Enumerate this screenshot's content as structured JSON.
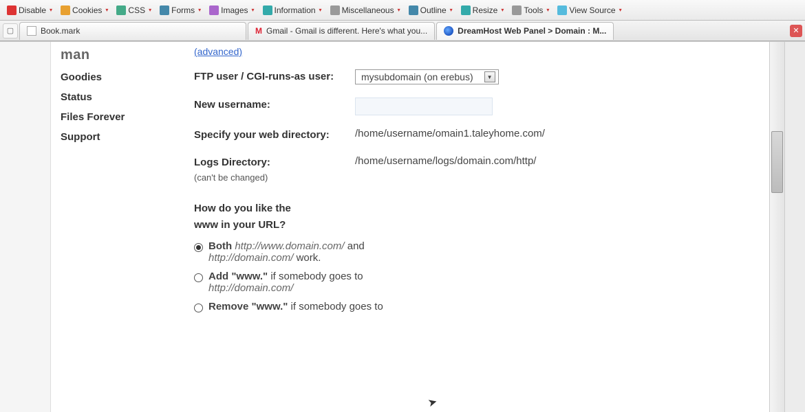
{
  "devtoolbar": {
    "items": [
      {
        "icon": "ico-red",
        "label": "Disable"
      },
      {
        "icon": "ico-orange",
        "label": "Cookies"
      },
      {
        "icon": "ico-green",
        "label": "CSS"
      },
      {
        "icon": "ico-blue",
        "label": "Forms"
      },
      {
        "icon": "ico-purple",
        "label": "Images"
      },
      {
        "icon": "ico-teal",
        "label": "Information"
      },
      {
        "icon": "ico-gray",
        "label": "Miscellaneous"
      },
      {
        "icon": "ico-blue",
        "label": "Outline"
      },
      {
        "icon": "ico-teal",
        "label": "Resize"
      },
      {
        "icon": "ico-gray",
        "label": "Tools"
      },
      {
        "icon": "ico-cyan",
        "label": "View Source"
      }
    ]
  },
  "tabs": {
    "tab1": "Book.mark",
    "tab2": "Gmail - Gmail is different. Here's what you...",
    "tab3": "DreamHost Web Panel > Domain : M..."
  },
  "sidebar": {
    "brand": "man",
    "items": [
      "Goodies",
      "Status",
      "Files Forever",
      "Support"
    ]
  },
  "form": {
    "advanced": "(advanced)",
    "ftp_label": "FTP user / CGI-runs-as user:",
    "ftp_select": "mysubdomain (on erebus)",
    "new_user_label": "New username:",
    "webdir_label": "Specify your web directory:",
    "webdir_value": "/home/username/omain1.taleyhome.com/",
    "logs_label": "Logs Directory:",
    "logs_sub": "(can't be changed)",
    "logs_value": "/home/username/logs/domain.com/http/",
    "www_question_l1": "How do you like the",
    "www_question_l2": "www in your URL?",
    "opt_both_b": "Both",
    "opt_both_u1": "http://www.domain.com/",
    "opt_both_mid": " and ",
    "opt_both_u2": "http://domain.com/",
    "opt_both_end": " work.",
    "opt_add_b": "Add \"www.\"",
    "opt_add_rest": " if somebody goes to ",
    "opt_add_u": "http://domain.com/",
    "opt_remove_b": "Remove \"www.\"",
    "opt_remove_rest": " if somebody goes to"
  }
}
